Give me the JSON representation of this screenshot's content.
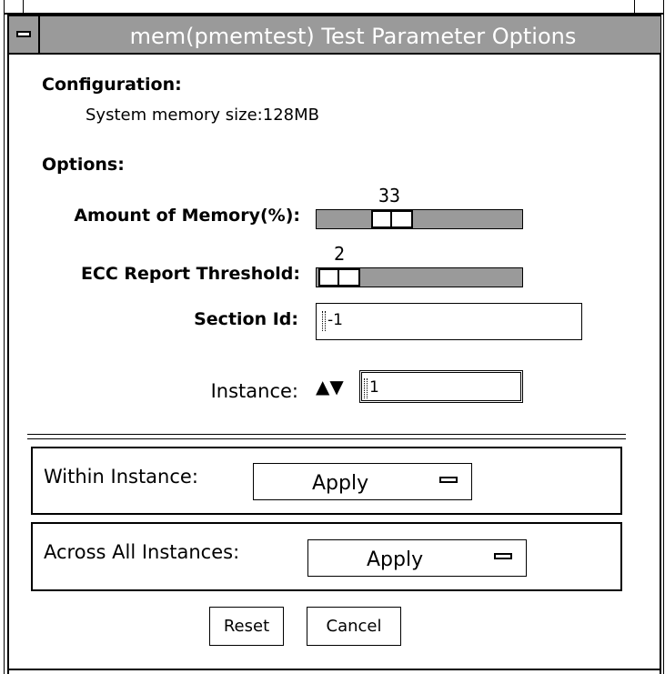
{
  "window": {
    "title": "mem(pmemtest) Test Parameter Options"
  },
  "configuration": {
    "heading": "Configuration:",
    "memory_size": "System memory size:128MB"
  },
  "options": {
    "heading": "Options:",
    "amount_of_memory": {
      "label": "Amount of Memory(%):",
      "value": "33",
      "value_percent": 33
    },
    "ecc_report_threshold": {
      "label": "ECC Report Threshold:",
      "value": "2"
    },
    "section_id": {
      "label": "Section Id:",
      "value": "-1"
    },
    "instance": {
      "label": "Instance:",
      "arrows": "▲▼",
      "value": "1"
    }
  },
  "within_instance": {
    "label": "Within Instance:",
    "menu_value": "Apply"
  },
  "across_all_instances": {
    "label": "Across All Instances:",
    "menu_value": "Apply"
  },
  "buttons": {
    "reset": "Reset",
    "cancel": "Cancel"
  }
}
